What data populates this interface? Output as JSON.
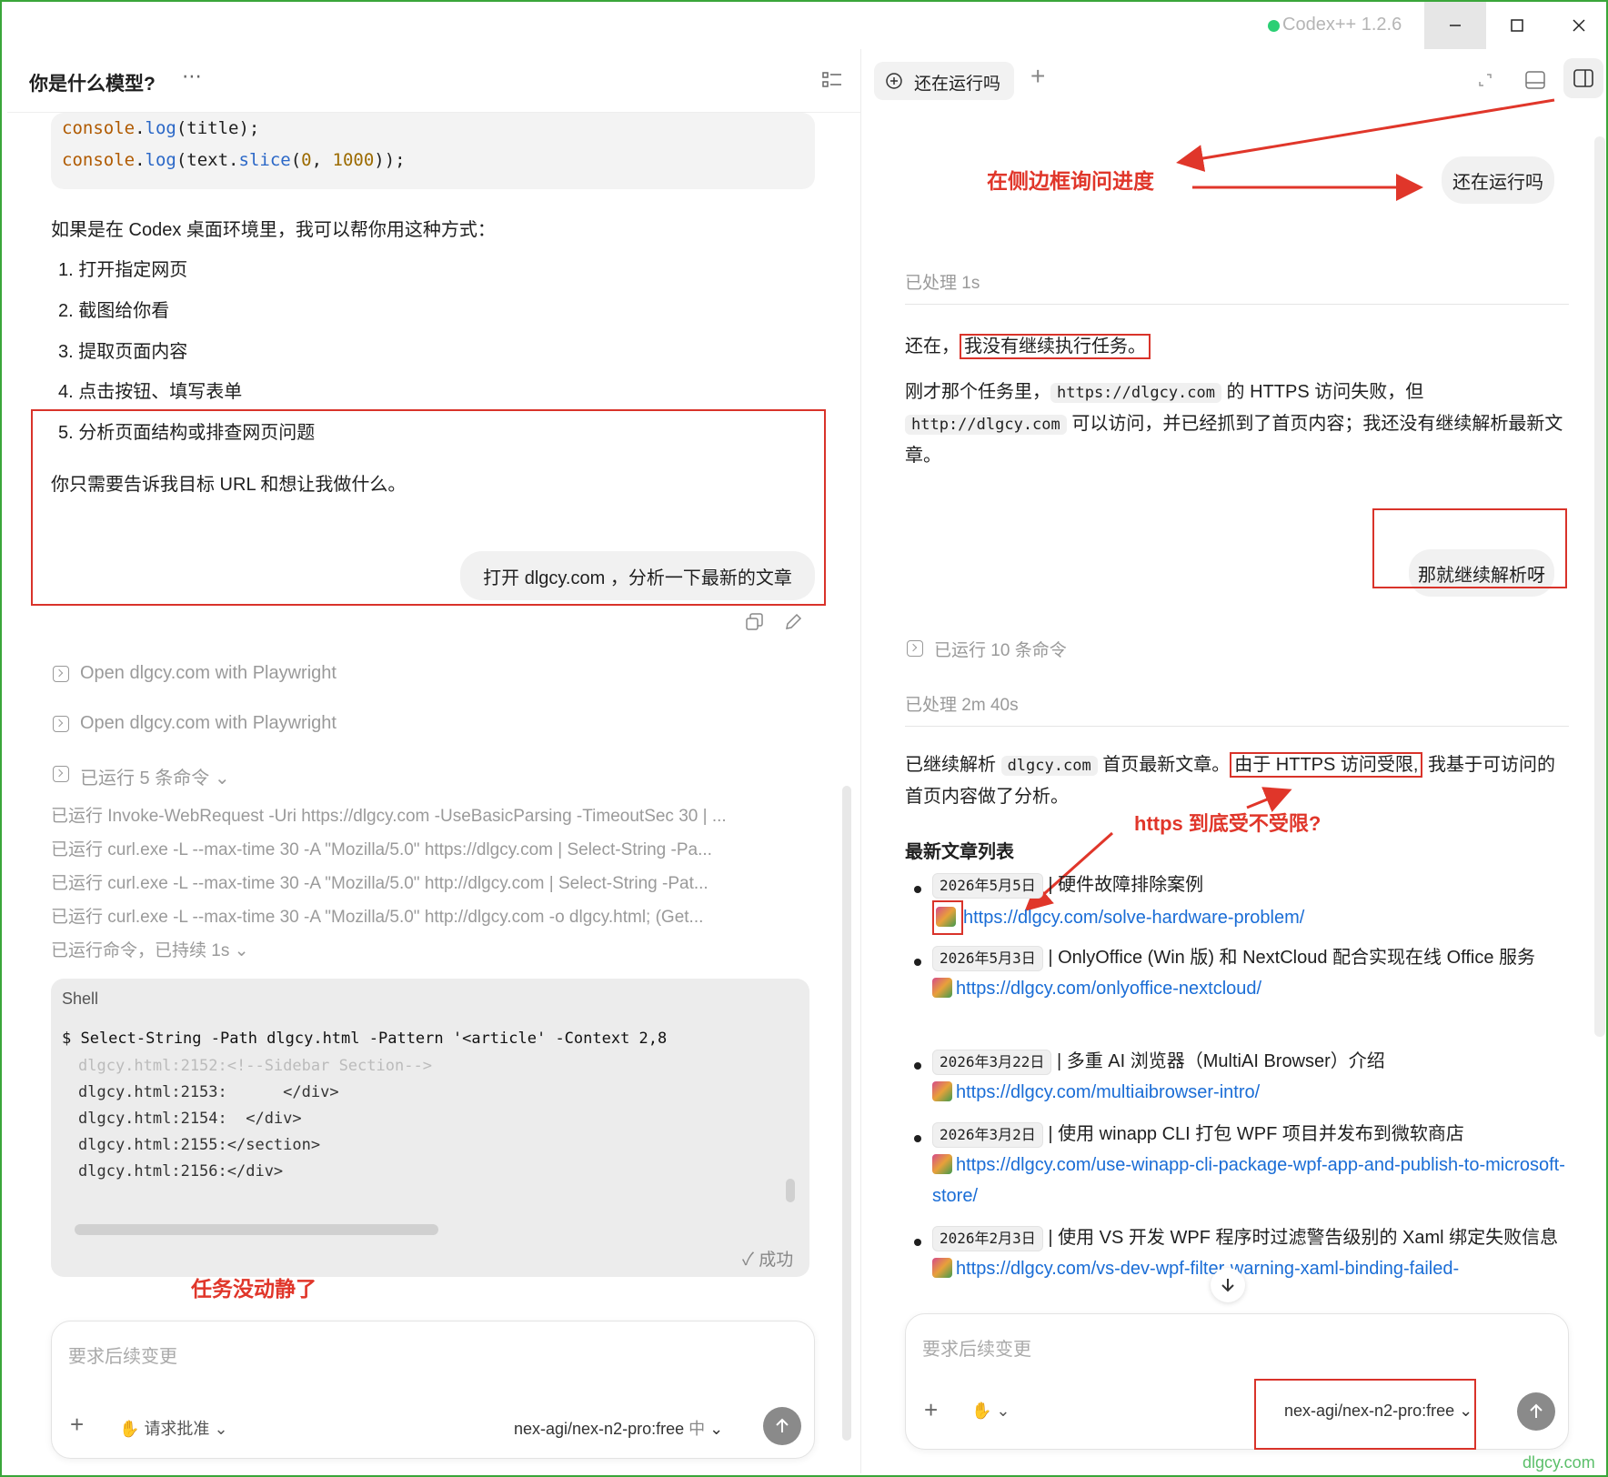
{
  "app": {
    "title": "Codex++ 1.2.6"
  },
  "left": {
    "header_title": "你是什么模型?",
    "code_lines": [
      {
        "obj": "console",
        "dot": ".",
        "fn": "log",
        "args_pre": "(title);",
        "num": "",
        "args_post": ""
      },
      {
        "obj": "console",
        "dot": ".",
        "fn": "log",
        "args_pre": "(text.",
        "fn2": "slice",
        "args_mid": "(",
        "num": "0",
        "sep": ", ",
        "num2": "1000",
        "args_post": "));"
      }
    ],
    "intro": "如果是在 Codex 桌面环境里，我可以帮你用这种方式：",
    "list": [
      "1. 打开指定网页",
      "2. 截图给你看",
      "3. 提取页面内容",
      "4. 点击按钮、填写表单",
      "5. 分析页面结构或排查网页问题"
    ],
    "outro": "你只需要告诉我目标 URL 和想让我做什么。",
    "user_bubble": "打开 dlgcy.com ，分析一下最新的文章",
    "steps": [
      "Open dlgcy.com with Playwright",
      "Open dlgcy.com with Playwright"
    ],
    "ran_summary": "已运行 5 条命令",
    "ran_cmds": [
      "已运行 Invoke-WebRequest -Uri https://dlgcy.com -UseBasicParsing -TimeoutSec 30 | ...",
      "已运行 curl.exe -L --max-time 30 -A \"Mozilla/5.0\" https://dlgcy.com | Select-String -Pa...",
      "已运行 curl.exe -L --max-time 30 -A \"Mozilla/5.0\" http://dlgcy.com | Select-String -Pat...",
      "已运行 curl.exe -L --max-time 30 -A \"Mozilla/5.0\" http://dlgcy.com -o dlgcy.html; (Get..."
    ],
    "running": "已运行命令，已持续 1s",
    "shell": {
      "label": "Shell",
      "command": "$ Select-String -Path dlgcy.html -Pattern '<article' -Context 2,8",
      "lines": [
        "dlgcy.html:2152:<!--Sidebar Section-->",
        "dlgcy.html:2153:      </div>",
        "dlgcy.html:2154:  </div>",
        "dlgcy.html:2155:</section>",
        "dlgcy.html:2156:</div>"
      ],
      "status": "✓ 成功"
    },
    "annotation_stalled": "任务没动静了",
    "input_placeholder": "要求后续变更",
    "approval_label": "请求批准",
    "model": "nex-agi/nex-n2-pro:free",
    "lang": "中"
  },
  "right": {
    "tab_label": "还在运行吗",
    "annotation_side": "在侧边框询问进度",
    "user_q1": "还在运行吗",
    "processed1": "已处理 1s",
    "reply1_pre": "还在，",
    "reply1_box": "我没有继续执行任务。",
    "reply2_a": "刚才那个任务里，",
    "reply2_code1": "https://dlgcy.com",
    "reply2_b": " 的 HTTPS 访问失败，但",
    "reply2_code2": "http://dlgcy.com",
    "reply2_c": " 可以访问，并已经抓到了首页内容；我还没有继续解析最新文章。",
    "user_q2": "那就继续解析呀",
    "ran10": "已运行 10 条命令",
    "processed2": "已处理 2m 40s",
    "reply3_a": "已继续解析 ",
    "reply3_code": "dlgcy.com",
    "reply3_b": " 首页最新文章。",
    "reply3_box": "由于 HTTPS 访问受限,",
    "reply3_c": " 我基于可访问的首页内容做了分析。",
    "annotation_https": "https 到底受不受限?",
    "list_title": "最新文章列表",
    "articles": [
      {
        "date": "2026年5月5日",
        "title": "硬件故障排除案例",
        "url": "https://dlgcy.com/solve-hardware-problem/"
      },
      {
        "date": "2026年5月3日",
        "title": "OnlyOffice (Win 版) 和 NextCloud 配合实现在线 Office 服务",
        "url": "https://dlgcy.com/onlyoffice-nextcloud/"
      },
      {
        "date": "2026年3月22日",
        "title": "多重 AI 浏览器（MultiAI Browser）介绍",
        "url": "https://dlgcy.com/multiaibrowser-intro/"
      },
      {
        "date": "2026年3月2日",
        "title": "使用 winapp CLI 打包 WPF 项目并发布到微软商店",
        "url": "https://dlgcy.com/use-winapp-cli-package-wpf-app-and-publish-to-microsoft-store/"
      },
      {
        "date": "2026年2月3日",
        "title": "使用 VS 开发 WPF 程序时过滤警告级别的 Xaml 绑定失败信息",
        "url": "https://dlgcy.com/vs-dev-wpf-filter-warning-xaml-binding-failed-"
      }
    ],
    "input_placeholder": "要求后续变更",
    "model": "nex-agi/nex-n2-pro:free"
  },
  "watermark": "dlgcy.com",
  "colors": {
    "annotation_red": "#e0362a",
    "link_blue": "#1a6dd6",
    "status_green": "#2bcf74"
  }
}
